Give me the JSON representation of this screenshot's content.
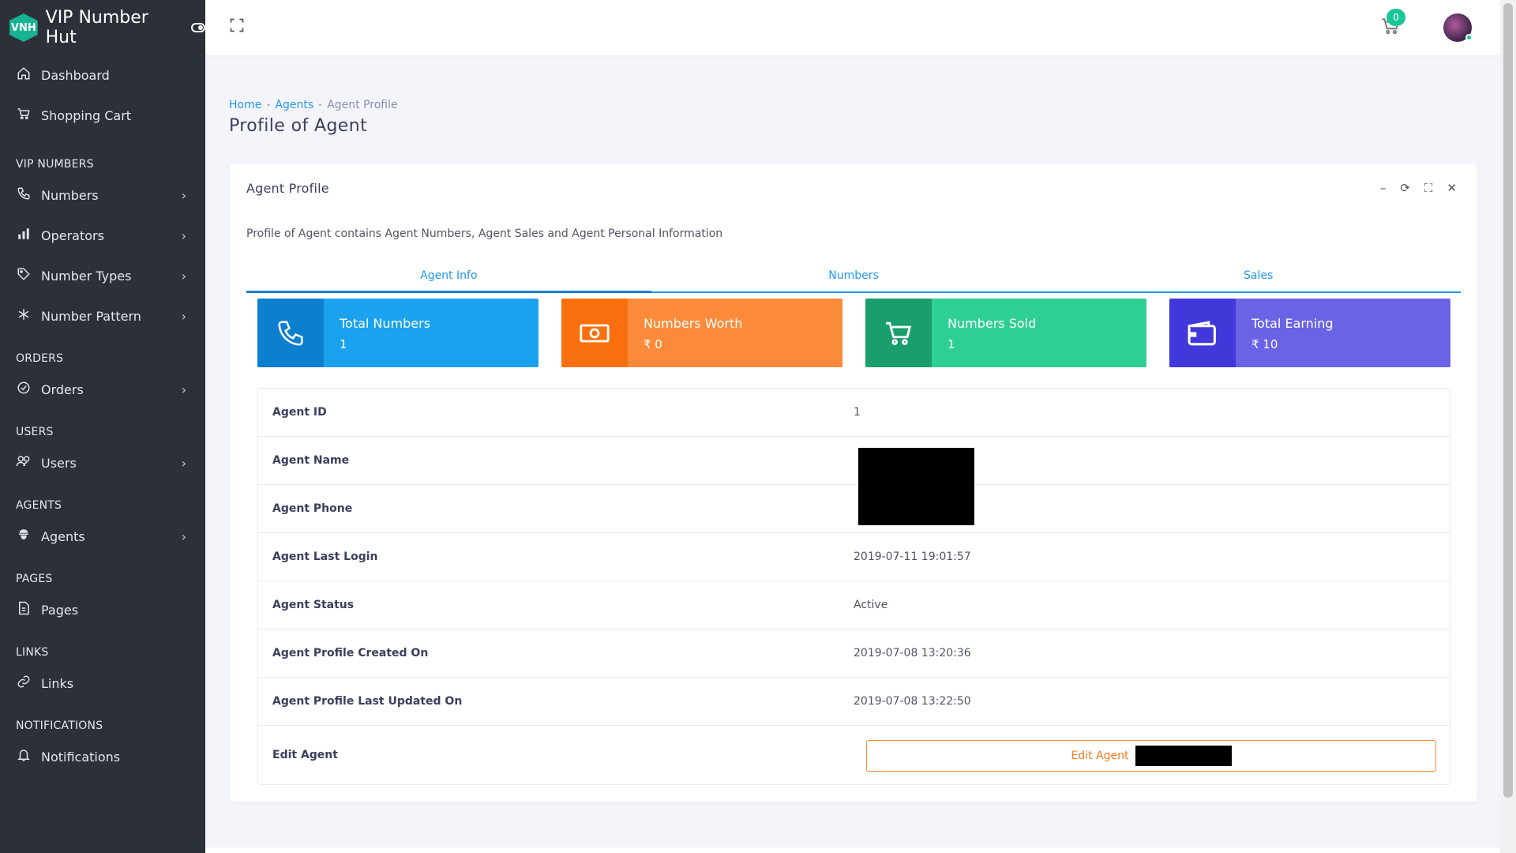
{
  "brand": {
    "logo_text": "VNH",
    "name": "VIP Number Hut"
  },
  "sidebar": {
    "top_items": [
      {
        "label": "Dashboard",
        "icon": "home-icon"
      },
      {
        "label": "Shopping Cart",
        "icon": "cart-icon"
      }
    ],
    "sections": [
      {
        "title": "VIP NUMBERS",
        "items": [
          {
            "label": "Numbers",
            "icon": "phone-icon"
          },
          {
            "label": "Operators",
            "icon": "bar-chart-icon"
          },
          {
            "label": "Number Types",
            "icon": "tag-icon"
          },
          {
            "label": "Number Pattern",
            "icon": "asterisk-icon"
          }
        ]
      },
      {
        "title": "ORDERS",
        "items": [
          {
            "label": "Orders",
            "icon": "check-circle-icon"
          }
        ]
      },
      {
        "title": "USERS",
        "items": [
          {
            "label": "Users",
            "icon": "users-icon"
          }
        ]
      },
      {
        "title": "AGENTS",
        "items": [
          {
            "label": "Agents",
            "icon": "agent-icon"
          }
        ]
      },
      {
        "title": "PAGES",
        "items": [
          {
            "label": "Pages",
            "icon": "file-icon"
          }
        ]
      },
      {
        "title": "LINKS",
        "items": [
          {
            "label": "Links",
            "icon": "link-icon"
          }
        ]
      },
      {
        "title": "NOTIFICATIONS",
        "items": [
          {
            "label": "Notifications",
            "icon": "bell-icon"
          }
        ]
      }
    ]
  },
  "header": {
    "cart_count": "0"
  },
  "breadcrumb": {
    "home": "Home",
    "agents": "Agents",
    "current": "Agent Profile",
    "sep": "-"
  },
  "page_title": "Profile of Agent",
  "card": {
    "title": "Agent Profile",
    "description": "Profile of Agent contains Agent Numbers, Agent Sales and Agent Personal Information",
    "tools": {
      "minimize": "–",
      "refresh": "⟳",
      "fullscreen": "⛶",
      "close": "✕"
    }
  },
  "tabs": [
    "Agent Info",
    "Numbers",
    "Sales"
  ],
  "stats": [
    {
      "label": "Total Numbers",
      "value": "1",
      "icon": "phone-icon"
    },
    {
      "label": "Numbers Worth",
      "value": "₹ 0",
      "icon": "money-icon"
    },
    {
      "label": "Numbers Sold",
      "value": "1",
      "icon": "cart-icon"
    },
    {
      "label": "Total Earning",
      "value": "₹ 10",
      "icon": "wallet-icon"
    }
  ],
  "info_rows": [
    {
      "label": "Agent ID",
      "value": "1"
    },
    {
      "label": "Agent Name",
      "value": ""
    },
    {
      "label": "Agent Phone",
      "value": ""
    },
    {
      "label": "Agent Last Login",
      "value": "2019-07-11 19:01:57"
    },
    {
      "label": "Agent Status",
      "value": "Active"
    },
    {
      "label": "Agent Profile Created On",
      "value": "2019-07-08 13:20:36"
    },
    {
      "label": "Agent Profile Last Updated On",
      "value": "2019-07-08 13:22:50"
    },
    {
      "label": "Edit Agent",
      "value": ""
    }
  ],
  "edit_button": "Edit Agent",
  "colors": {
    "sidebar": "#2b3039",
    "accent": "#2196f3",
    "brand": "#17b392"
  }
}
